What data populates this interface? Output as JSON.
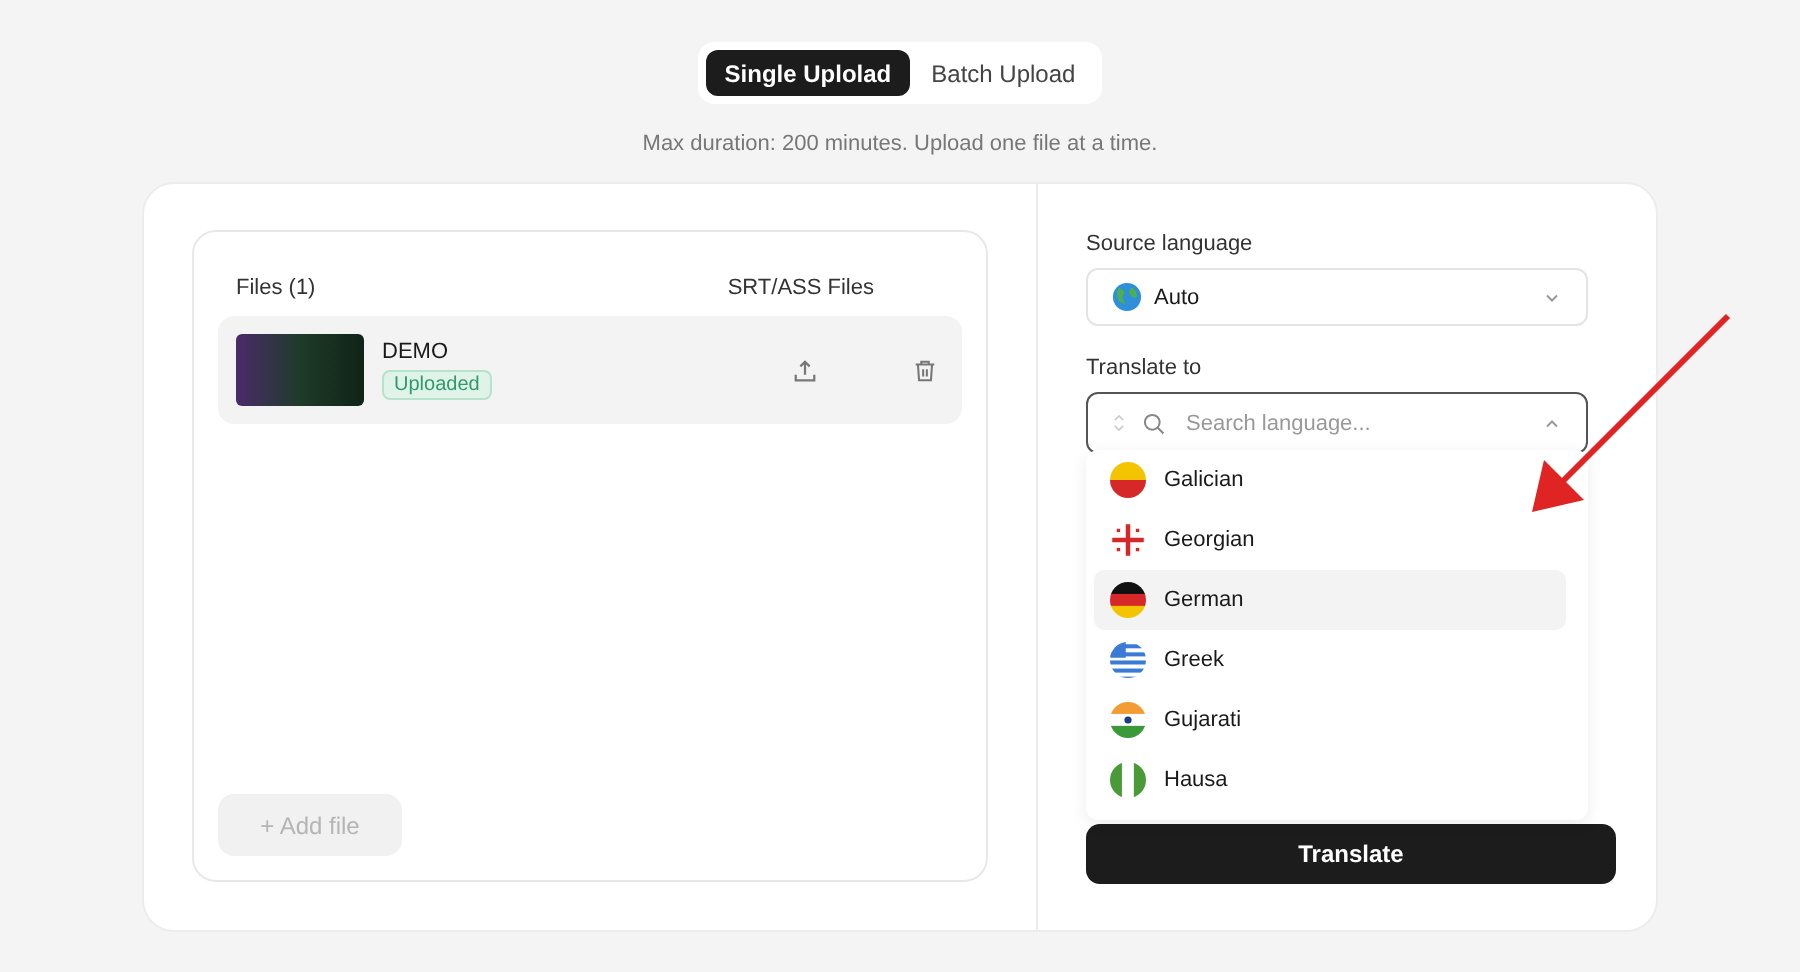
{
  "upload_tabs": [
    {
      "label": "Single Uplolad",
      "selected": true
    },
    {
      "label": "Batch Upload",
      "selected": false
    }
  ],
  "subtitle": "Max duration: 200 minutes. Upload one file at a time.",
  "files": {
    "header": "Files (1)",
    "subtitle_column": "SRT/ASS Files",
    "items": [
      {
        "name": "DEMO",
        "status": "Uploaded"
      }
    ],
    "add_button": {
      "label": "+ Add file",
      "disabled": true
    }
  },
  "source_language": {
    "label": "Source language",
    "value": "Auto"
  },
  "translate_to": {
    "label": "Translate to",
    "placeholder": "Search language...",
    "expanded": true,
    "options": [
      {
        "label": "Galician",
        "selected": false
      },
      {
        "label": "Georgian",
        "selected": false
      },
      {
        "label": "German",
        "selected": true
      },
      {
        "label": "Greek",
        "selected": false
      },
      {
        "label": "Gujarati",
        "selected": false
      },
      {
        "label": "Hausa",
        "selected": false
      }
    ]
  },
  "translate_button": "Translate"
}
